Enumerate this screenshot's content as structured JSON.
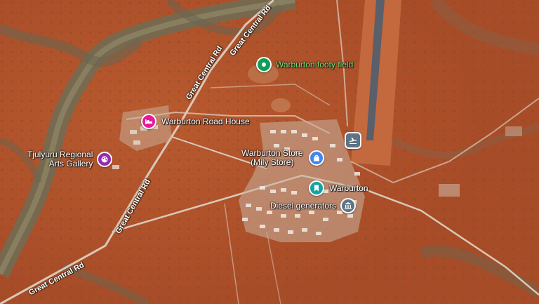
{
  "map": {
    "colors": {
      "terrain": "#b5552b",
      "river_vegetation": "#6b6a52",
      "airstrip": "#c4683e",
      "runway": "#5a5f6a",
      "town": "#c9b3a0",
      "road": "#d9c8b8"
    },
    "roads": {
      "great_central_1": "Great Central Rd",
      "great_central_2": "Great Central Rd",
      "great_central_3": "Great Central Rd",
      "great_central_4": "Great Central Rd",
      "great_central_5": "Great Central Rd"
    },
    "pois": {
      "footy_field": {
        "label": "Warburton footy field",
        "color": "#0f9d58",
        "icon": "park-icon"
      },
      "road_house": {
        "label": "Warburton Road House",
        "color": "#e8199b",
        "icon": "hotel-bed-icon"
      },
      "arts_gallery": {
        "line1": "Tjulyuru Regional",
        "line2": "Arts Gallery",
        "color": "#9c27b0",
        "icon": "palette-icon"
      },
      "store": {
        "line1": "Warburton Store",
        "line2": "(Mily Store)",
        "color": "#4285f4",
        "icon": "shopping-bag-icon"
      },
      "town": {
        "label": "Warburton",
        "color": "#12a4a4",
        "icon": "bookmark-icon"
      },
      "diesel": {
        "label": "Diesel generators",
        "color": "#5f7384",
        "icon": "building-columns-icon"
      },
      "airport": {
        "color": "#5f7384",
        "icon": "airplane-icon"
      }
    }
  }
}
